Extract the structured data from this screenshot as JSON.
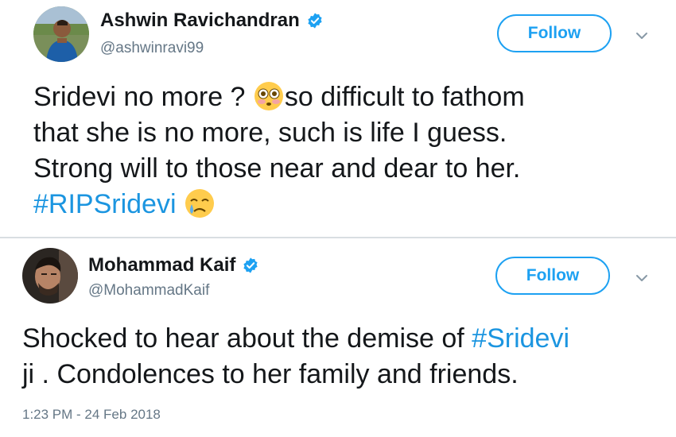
{
  "tweets": [
    {
      "author_name": "Ashwin Ravichandran",
      "handle": "@ashwinravi99",
      "follow_label": "Follow",
      "text": {
        "line1_part1": "Sridevi no more ? ",
        "line1_part2": "so difficult to fathom",
        "line2": "that she is no more, such is life I guess.",
        "line3": "Strong will to those near and dear to her.",
        "hashtag": "#RIPSridevi"
      },
      "emojis": [
        "flushed-face",
        "crying-face"
      ]
    },
    {
      "author_name": "Mohammad Kaif",
      "handle": "@MohammadKaif",
      "follow_label": "Follow",
      "text": {
        "line1_part1": "Shocked to hear about the demise of ",
        "hashtag": "#Sridevi",
        "line2": "ji . Condolences to her family and friends."
      },
      "timestamp": "1:23 PM - 24 Feb 2018"
    }
  ],
  "colors": {
    "link_blue": "#1b95e0",
    "follow_blue": "#1da1f2",
    "secondary_gray": "#657786",
    "text_dark": "#14171a"
  }
}
